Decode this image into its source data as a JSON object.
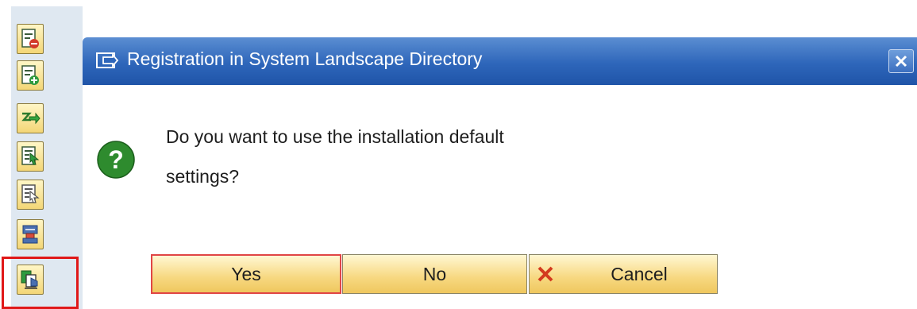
{
  "toolbar": {
    "buttons": [
      {
        "icon": "remove-entry-icon"
      },
      {
        "icon": "add-entry-icon"
      },
      {
        "icon": "execute-arrow-icon"
      },
      {
        "icon": "select-document-icon"
      },
      {
        "icon": "display-document-icon"
      },
      {
        "icon": "configuration-icon"
      },
      {
        "icon": "copy-document-icon"
      }
    ],
    "highlighted_button": "copy-document-icon"
  },
  "dialog": {
    "title": "Registration in System Landscape Directory",
    "message_line1": "Do you want to use the installation default",
    "message_line2": "settings?",
    "buttons": {
      "yes": "Yes",
      "no": "No",
      "cancel": "Cancel"
    }
  },
  "colors": {
    "title_bar": "#2e66ba",
    "button_fill": "#f7d880",
    "highlight_border": "#e01818",
    "question_icon": "#2e8b2e",
    "cancel_x": "#d33a1f"
  }
}
